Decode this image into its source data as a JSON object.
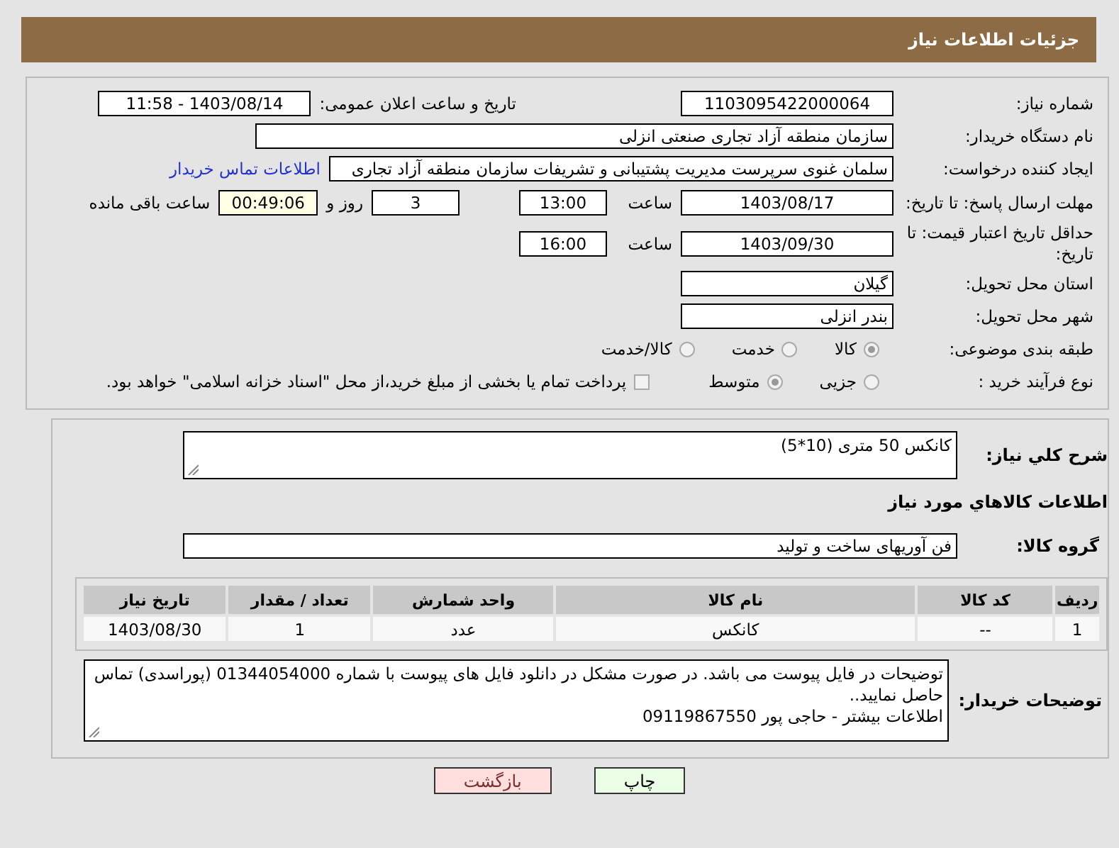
{
  "header": {
    "title": "جزئیات اطلاعات نیاز"
  },
  "need_number": {
    "label": "شماره نیاز:",
    "value": "1103095422000064"
  },
  "announce": {
    "label": "تاریخ و ساعت اعلان عمومی:",
    "value": "1403/08/14 - 11:58"
  },
  "buyer_org": {
    "label": "نام دستگاه خریدار:",
    "value": "سازمان منطقه آزاد تجاری  صنعتی انزلی"
  },
  "requester": {
    "label": "ایجاد کننده درخواست:",
    "value": "سلمان غنوی سرپرست مدیریت پشتیبانی و تشریفات سازمان منطقه آزاد تجاری",
    "link": "اطلاعات تماس خریدار"
  },
  "reply_deadline": {
    "label": "مهلت ارسال پاسخ: تا تاریخ:",
    "date": "1403/08/17",
    "time_label": "ساعت",
    "time": "13:00",
    "days": "3",
    "days_label": "روز و",
    "remaining": "00:49:06",
    "remaining_label": "ساعت باقی مانده"
  },
  "price_validity": {
    "label": "حداقل تاریخ اعتبار قیمت: تا تاریخ:",
    "date": "1403/09/30",
    "time_label": "ساعت",
    "time": "16:00"
  },
  "province": {
    "label": "استان محل تحویل:",
    "value": "گیلان"
  },
  "city": {
    "label": "شهر محل تحویل:",
    "value": "بندر انزلی"
  },
  "category": {
    "label": "طبقه بندی موضوعی:",
    "options": [
      {
        "label": "کالا",
        "selected": true
      },
      {
        "label": "خدمت",
        "selected": false
      },
      {
        "label": "کالا/خدمت",
        "selected": false
      }
    ]
  },
  "process": {
    "label": "نوع فرآیند خرید :",
    "options": [
      {
        "label": "جزیی",
        "selected": false
      },
      {
        "label": "متوسط",
        "selected": true
      }
    ],
    "payment": {
      "label": "پرداخت تمام یا بخشی از مبلغ خرید،از محل \"اسناد خزانه اسلامی\" خواهد بود.",
      "checked": false
    }
  },
  "description": {
    "label": "شرح کلي نیاز:",
    "value": "کانکس 50 متری (10*5)"
  },
  "goods_section": {
    "title": "اطلاعات کالاهاي مورد نیاز",
    "group_label": "گروه کالا:",
    "group_value": "فن آوریهای ساخت و تولید"
  },
  "table": {
    "columns": [
      "ردیف",
      "کد کالا",
      "نام کالا",
      "واحد شمارش",
      "تعداد / مقدار",
      "تاریخ نیاز"
    ],
    "rows": [
      [
        "1",
        "--",
        "کانکس",
        "عدد",
        "1",
        "1403/08/30"
      ]
    ]
  },
  "buyer_notes": {
    "label": "توضیحات خریدار:",
    "value": "توضیحات در فایل پیوست می باشد. در صورت مشکل در دانلود فایل های پیوست با شماره 01344054000 (پوراسدی) تماس حاصل نمایید..\nاطلاعات بیشتر - حاجی پور 09119867550"
  },
  "buttons": [
    {
      "label": "چاپ",
      "kind": "print"
    },
    {
      "label": "بازگشت",
      "kind": "back"
    }
  ]
}
